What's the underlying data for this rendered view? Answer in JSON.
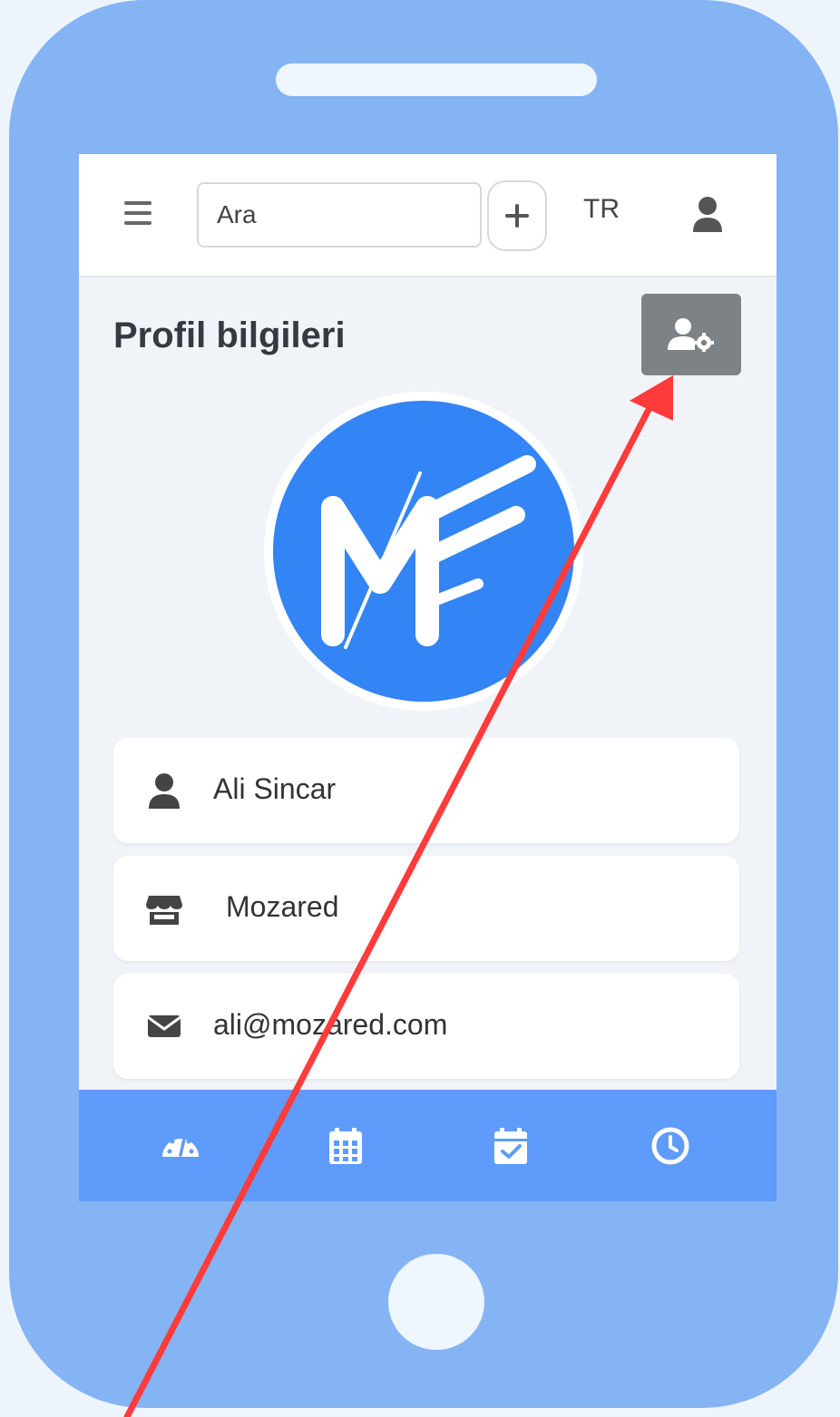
{
  "topbar": {
    "menu_icon": "bars-icon",
    "search_placeholder": "Ara",
    "add_icon": "plus-icon",
    "language": "TR",
    "user_icon": "user-icon"
  },
  "page": {
    "title": "Profil bilgileri",
    "settings_icon": "user-cog-icon"
  },
  "avatar": {
    "logo_text": "ME",
    "brand_color": "#3384f4"
  },
  "info": [
    {
      "icon": "user-icon",
      "text": "Ali Sincar"
    },
    {
      "icon": "store-icon",
      "text": "Mozared"
    },
    {
      "icon": "envelope-icon",
      "text": "ali@mozared.com"
    }
  ],
  "bottom_nav": [
    {
      "icon": "tachometer-icon"
    },
    {
      "icon": "calendar-icon"
    },
    {
      "icon": "calendar-check-icon"
    },
    {
      "icon": "clock-icon"
    }
  ],
  "colors": {
    "phone_body": "#85b4f5",
    "bottom_nav": "#5f9bfb",
    "settings_button": "#7d8287",
    "annotation_arrow": "#ff3b3b"
  }
}
